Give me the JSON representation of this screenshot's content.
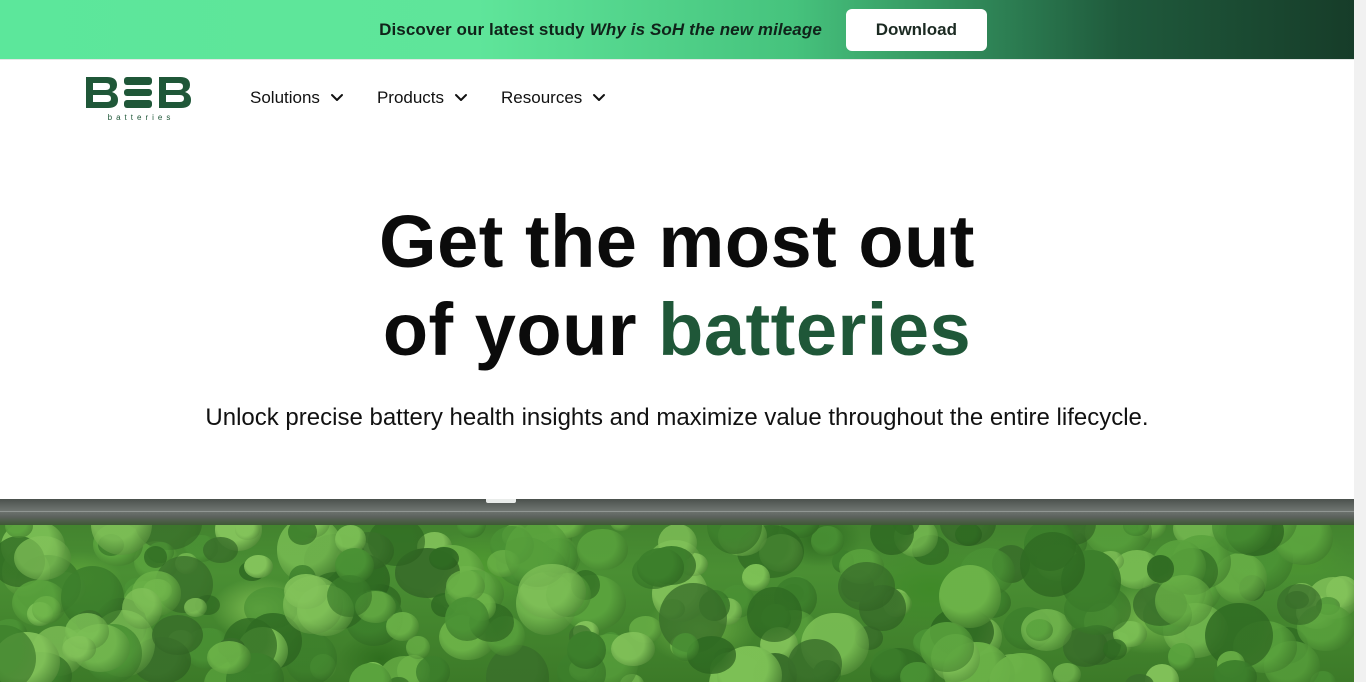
{
  "promo": {
    "text": "Discover our latest study",
    "emphasis": "Why is SoH the new mileage",
    "button_label": "Download"
  },
  "brand": {
    "logo_text": "B■B",
    "logo_subtext": "batteries",
    "color": "#1f5738"
  },
  "nav": {
    "items": [
      {
        "label": "Solutions",
        "icon": "chevron-down-icon"
      },
      {
        "label": "Products",
        "icon": "chevron-down-icon"
      },
      {
        "label": "Resources",
        "icon": "chevron-down-icon"
      }
    ]
  },
  "hero": {
    "title_line1": "Get the most out",
    "title_line2_prefix": "of your",
    "title_line2_accent": "batteries",
    "accent_color": "#1f5738",
    "subtitle": "Unlock precise battery health insights and maximize value throughout the entire lifecycle."
  }
}
